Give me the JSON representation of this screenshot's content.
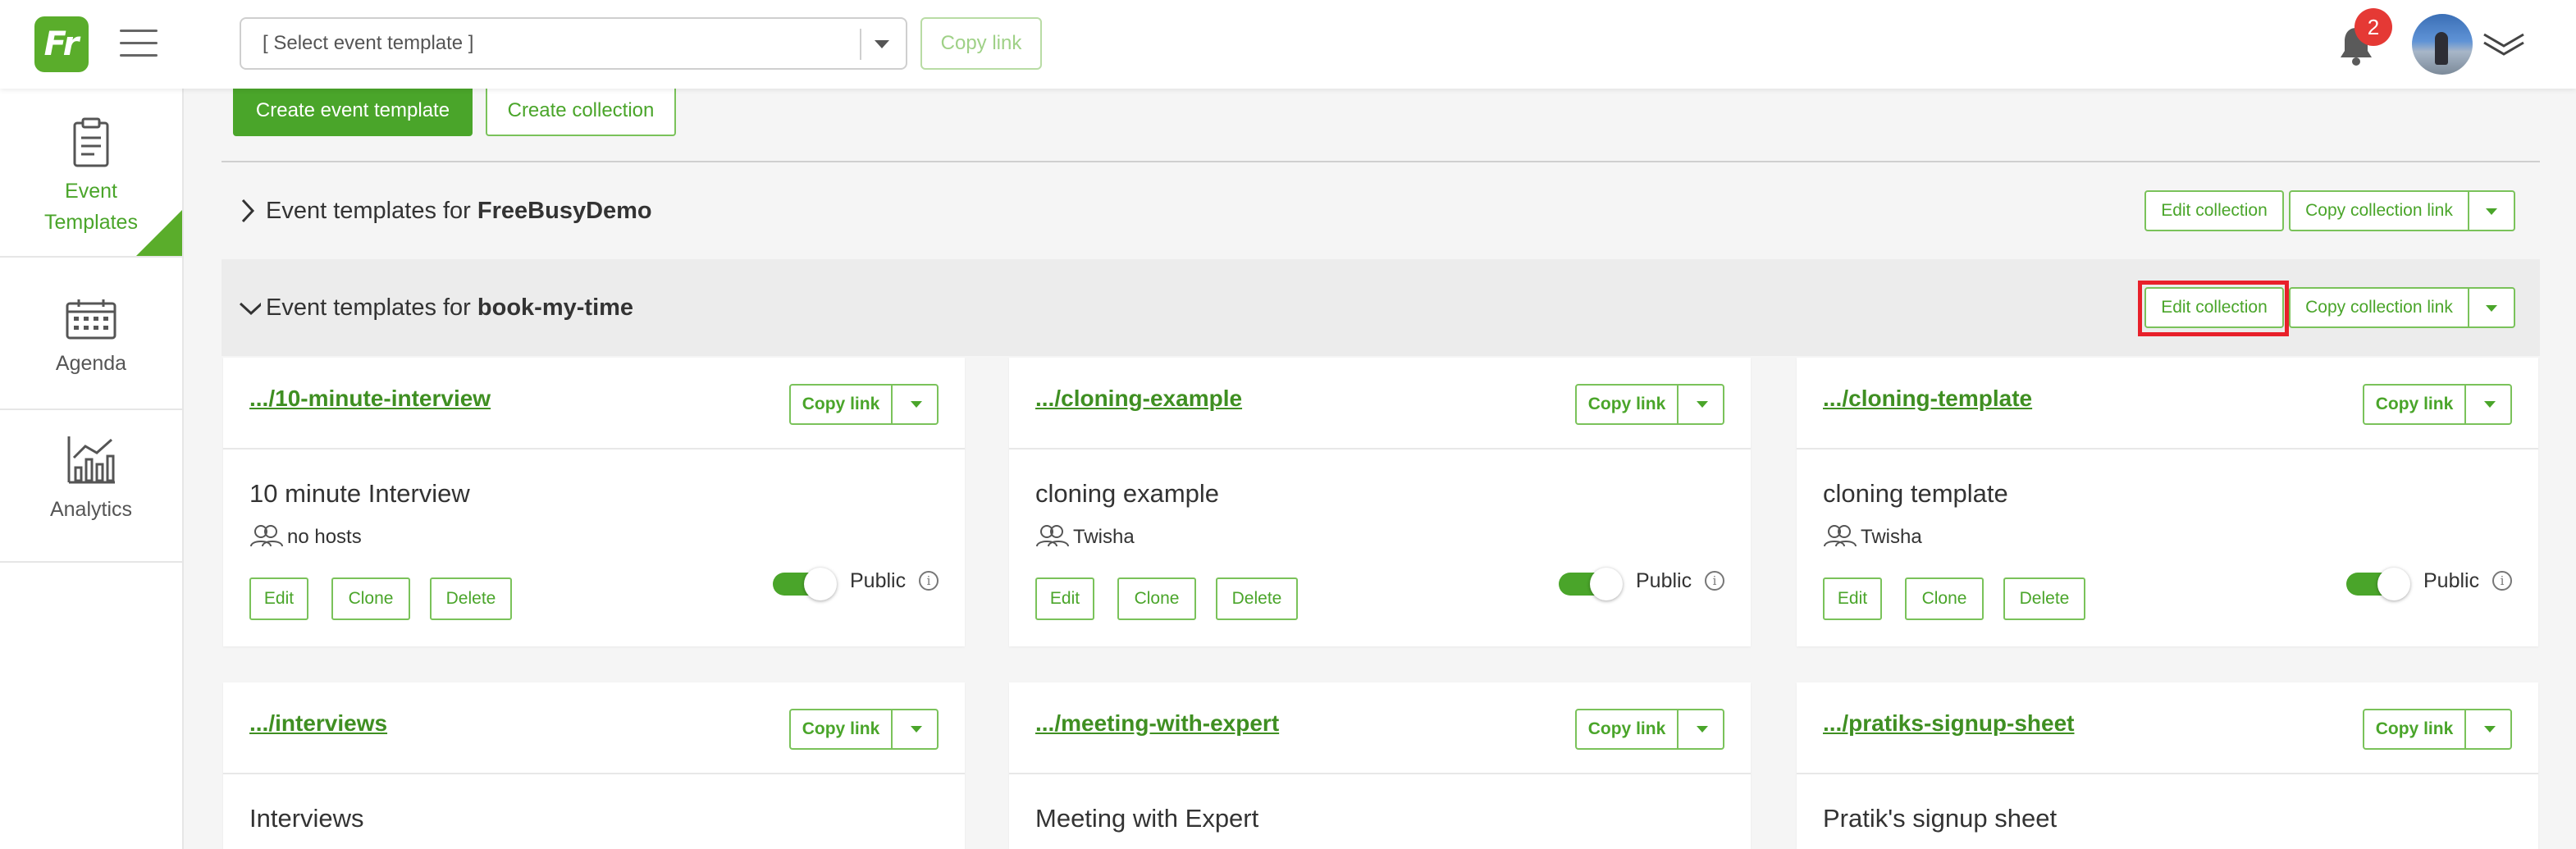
{
  "header": {
    "logo_text": "Fr",
    "template_select_value": "[ Select event template ]",
    "copy_link_label": "Copy link",
    "notification_count": "2"
  },
  "sidebar": {
    "items": [
      {
        "label_line1": "Event",
        "label_line2": "Templates",
        "icon": "clipboard-icon",
        "active": true
      },
      {
        "label": "Agenda",
        "icon": "calendar-icon"
      },
      {
        "label": "Analytics",
        "icon": "chart-icon"
      }
    ]
  },
  "actions": {
    "create_template_label": "Create event template",
    "create_collection_label": "Create collection"
  },
  "collections": [
    {
      "prefix": "Event templates for ",
      "name": "FreeBusyDemo",
      "expanded": false
    },
    {
      "prefix": "Event templates for ",
      "name": "book-my-time",
      "expanded": true
    }
  ],
  "collection_buttons": {
    "edit_label": "Edit collection",
    "copy_label": "Copy collection link"
  },
  "cards": [
    {
      "link": ".../10-minute-interview",
      "name": "10 minute Interview",
      "hosts": "no hosts"
    },
    {
      "link": ".../cloning-example",
      "name": "cloning example",
      "hosts": "Twisha"
    },
    {
      "link": ".../cloning-template",
      "name": "cloning template",
      "hosts": "Twisha"
    },
    {
      "link": ".../interviews",
      "name": "Interviews"
    },
    {
      "link": ".../meeting-with-expert",
      "name": "Meeting with Expert"
    },
    {
      "link": ".../pratiks-signup-sheet",
      "name": "Pratik's signup sheet"
    }
  ],
  "card_labels": {
    "copy_link": "Copy link",
    "edit": "Edit",
    "clone": "Clone",
    "delete": "Delete",
    "public": "Public",
    "info": "i"
  },
  "colors": {
    "brand_green": "#4aa52a",
    "highlight_red": "#e8202a",
    "badge_red": "#e53935"
  }
}
